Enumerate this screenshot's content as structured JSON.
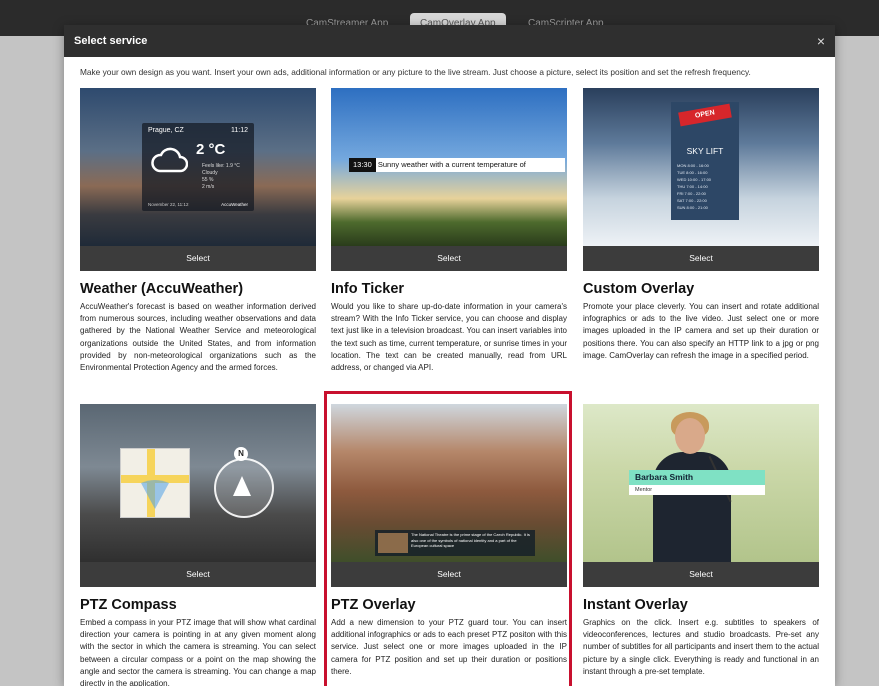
{
  "background": {
    "tabs": [
      "CamStreamer App",
      "CamOverlay App",
      "CamScripter App"
    ],
    "active_tab": 1
  },
  "modal": {
    "title": "Select service",
    "close_glyph": "×",
    "intro": "Make your own design as you want. Insert your own ads, additional information or any picture to the live stream. Just choose a picture, select its position and set the refresh frequency.",
    "select_label": "Select",
    "highlight_color": "#c8102e"
  },
  "cards": [
    {
      "title": "Weather (AccuWeather)",
      "desc": "AccuWeather's forecast is based on weather information derived from numerous sources, including weather observations and data gathered by the National Weather Service and meteorological organizations outside the United States, and from information provided by non-meteorological organizations such as the Environmental Protection Agency and the armed forces.",
      "thumb": {
        "location": "Prague, CZ",
        "time": "11:12",
        "temp": "2 °C",
        "feels": "Feels like: 1.9 °C",
        "condition": "Cloudy",
        "humidity": "55 %",
        "wind": "2 m/s",
        "date": "November 22, 11:12",
        "brand": "AccuWeather"
      }
    },
    {
      "title": "Info Ticker",
      "desc": "Would you like to share up-do-date information in your camera's stream? With the Info Ticker service, you can choose and display text just like in a television broadcast. You can insert variables into the text such as time, current temperature, or sunrise times in your location. The text can be created manually, read from URL address, or changed via API.",
      "thumb": {
        "time": "13:30",
        "text": "Sunny weather with a current temperature of"
      }
    },
    {
      "title": "Custom Overlay",
      "desc": "Promote your place cleverly. You can insert and rotate additional infographics or ads to the live video. Just select one or more images uploaded in the IP camera and set up their duration or positions there. You can also specify an HTTP link to a jpg or png image. CamOverlay can refresh the image in a specified period.",
      "thumb": {
        "tag": "OPEN",
        "board_title": "SKY LIFT",
        "rows": [
          "MON 8:00 - 16:00",
          "TUE 8:00 - 16:00",
          "WED 10:00 - 17:00",
          "THU 7:00 - 14:00",
          "FRI 7:00 - 22:00",
          "SAT 7:00 - 22:00",
          "SUN 8:00 - 21:00"
        ]
      }
    },
    {
      "title": "PTZ Compass",
      "desc": "Embed a compass in your PTZ image that will show what cardinal direction your camera is pointing in at any given moment along with the sector in which the camera is streaming. You can select between a circular compass or a point on the map showing the angle and sector the camera is streaming. You can change a map directly in the application.",
      "thumb": {
        "north": "N"
      }
    },
    {
      "title": "PTZ Overlay",
      "desc": "Add a new dimension to your PTZ guard tour. You can insert additional infographics or ads to each preset PTZ positon with this service. Just select one or more images uploaded in the IP camera for PTZ position and set up their duration or positions there.",
      "thumb": {
        "caption": "The National Theatre is the prime stage of the Czech Republic. It is also one of the symbols of national identity and a part of the European cultural space"
      }
    },
    {
      "title": "Instant Overlay",
      "desc": "Graphics on the click. Insert e.g. subtitles to speakers of videoconferences, lectures and studio broadcasts. Pre-set any number of subtitles for all participants and insert them to the actual picture by a single click. Everything is ready and functional in an instant through a pre-set template.",
      "thumb": {
        "name": "Barbara Smith",
        "role": "Mentor"
      }
    }
  ]
}
